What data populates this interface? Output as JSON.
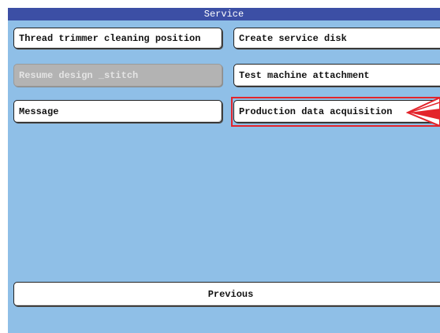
{
  "title": "Service",
  "buttons": {
    "thread_trimmer": "Thread trimmer cleaning position",
    "create_service_disk": "Create service disk",
    "resume_design": "Resume design _stitch",
    "test_machine": "Test machine attachment",
    "message": "Message",
    "production_data": "Production data acquisition",
    "previous": "Previous"
  },
  "colors": {
    "background": "#8fbfe7",
    "title_bar": "#3c4fa5",
    "highlight": "#e3242b"
  },
  "states": {
    "resume_design_enabled": false,
    "highlighted_button": "production_data"
  }
}
